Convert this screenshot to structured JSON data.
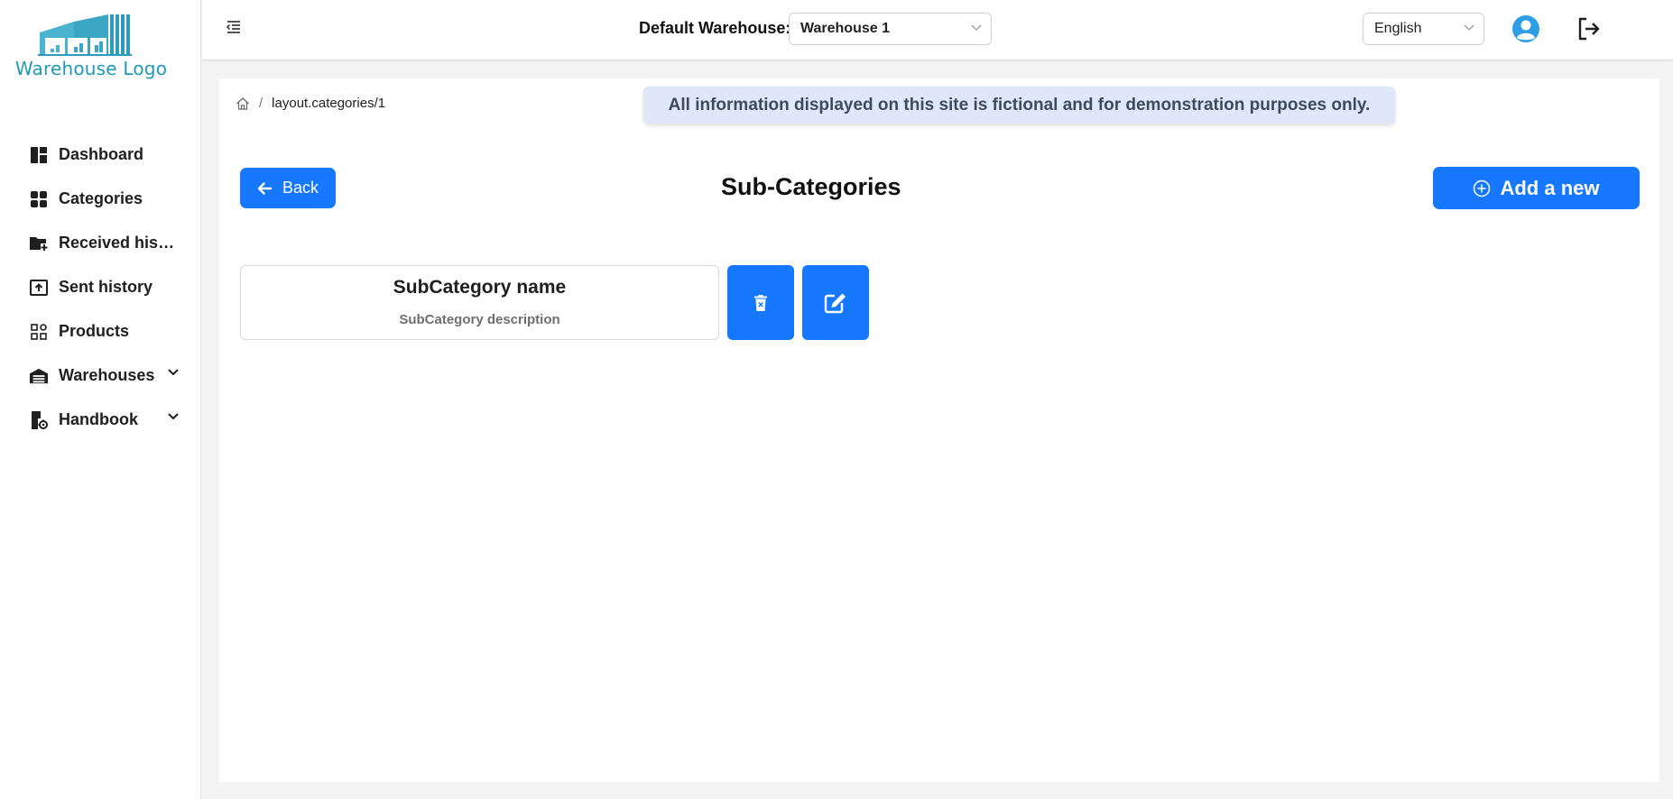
{
  "brand": {
    "logo_text": "Warehouse Logo",
    "accent_color": "#1677ff",
    "logo_color": "#1e9ab8"
  },
  "sidebar": {
    "items": [
      {
        "label": "Dashboard",
        "icon": "dashboard-icon"
      },
      {
        "label": "Categories",
        "icon": "categories-icon"
      },
      {
        "label": "Received histo...",
        "icon": "folder-plus-icon"
      },
      {
        "label": "Sent history",
        "icon": "upload-box-icon"
      },
      {
        "label": "Products",
        "icon": "products-grid-icon"
      },
      {
        "label": "Warehouses",
        "icon": "warehouse-icon",
        "expandable": true
      },
      {
        "label": "Handbook",
        "icon": "handbook-gear-icon",
        "expandable": true
      }
    ]
  },
  "header": {
    "default_warehouse_label": "Default Warehouse:",
    "warehouse_value": "Warehouse 1",
    "language_value": "English"
  },
  "breadcrumb": {
    "path": "layout.categories/1"
  },
  "notice": "All information displayed on this site is fictional and for demonstration purposes only.",
  "page": {
    "back_label": "Back",
    "title": "Sub-Categories",
    "add_label": "Add a new"
  },
  "subcategories": [
    {
      "name": "SubCategory name",
      "description": "SubCategory description"
    }
  ]
}
